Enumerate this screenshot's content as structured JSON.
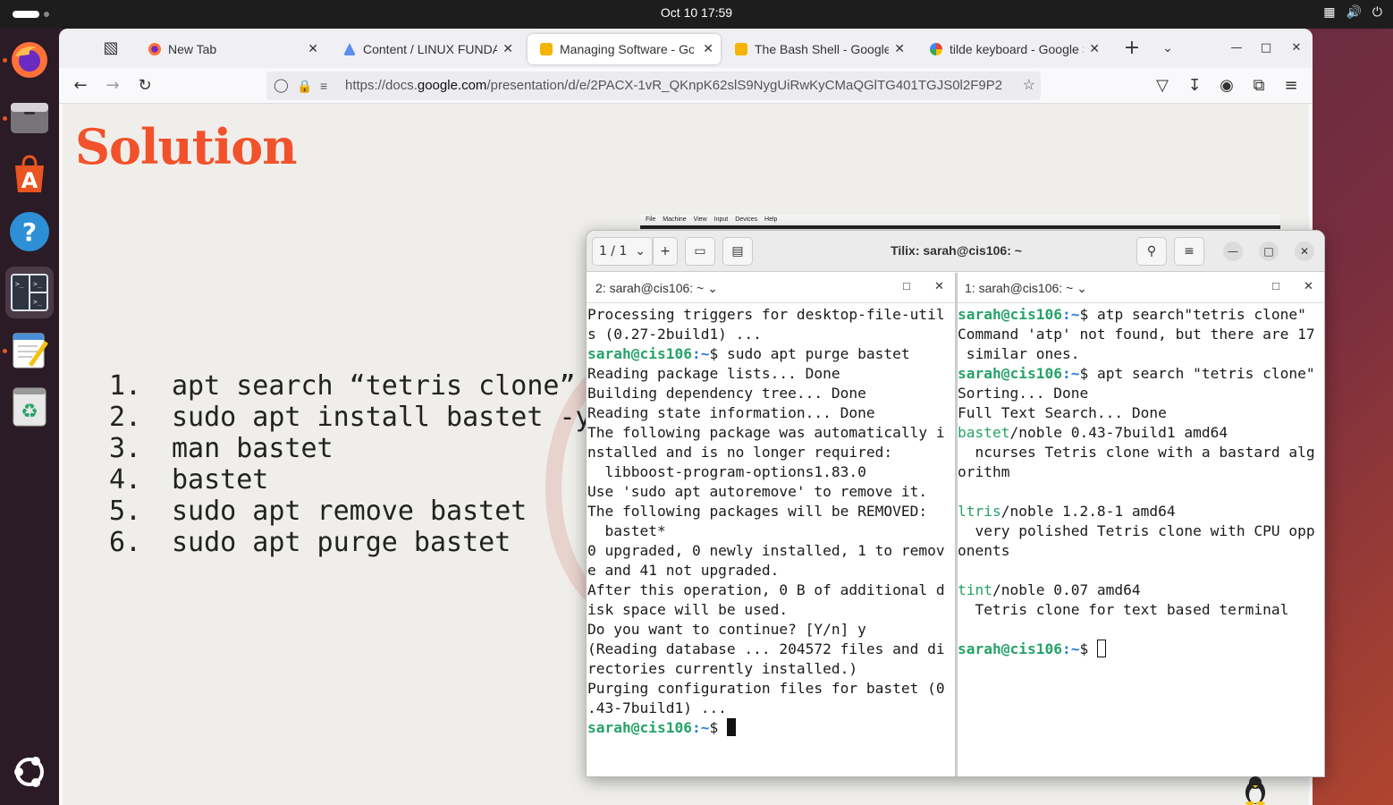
{
  "topbar": {
    "clock": "Oct 10  17:59"
  },
  "dock": {
    "items": [
      "firefox-icon",
      "files-icon",
      "app-center-icon",
      "help-icon",
      "tilix-icon",
      "text-editor-icon",
      "trash-icon",
      "ubuntu-apps-icon"
    ]
  },
  "browser": {
    "tabs": [
      {
        "label": "New Tab",
        "favicon": "firefox-icon",
        "active": false
      },
      {
        "label": "Content / LINUX FUNDA",
        "favicon": "d2l-icon",
        "active": false
      },
      {
        "label": "Managing Software - Go",
        "favicon": "slides-icon",
        "active": true
      },
      {
        "label": "The Bash Shell - Google S",
        "favicon": "slides-icon",
        "active": false
      },
      {
        "label": "tilde keyboard - Google S",
        "favicon": "google-icon",
        "active": false
      }
    ],
    "url": {
      "scheme": "https://docs.",
      "domain": "google.com",
      "path": "/presentation/d/e/2PACX-1vR_QKnpK62slS9NygUiRwKyCMaQGlTG401TGJS0l2F9P2"
    }
  },
  "slide": {
    "title": "Solution",
    "items": [
      {
        "n": "1.",
        "text": "apt search “tetris clone”"
      },
      {
        "n": "2.",
        "text": "sudo apt install bastet -y"
      },
      {
        "n": "3.",
        "text": "man bastet"
      },
      {
        "n": "4.",
        "text": "bastet"
      },
      {
        "n": "5.",
        "text": "sudo apt remove bastet"
      },
      {
        "n": "6.",
        "text": "sudo apt purge bastet"
      }
    ]
  },
  "vm_menu": [
    "File",
    "Machine",
    "View",
    "Input",
    "Devices",
    "Help"
  ],
  "tilix": {
    "title": "Tilix: sarah@cis106: ~",
    "session": "1 / 1",
    "left_pane": {
      "title": "2: sarah@cis106: ~",
      "lines": [
        "Processing triggers for desktop-file-util",
        "s (0.27-2build1) ...",
        "sudo apt purge bastet",
        "Reading package lists... Done",
        "Building dependency tree... Done",
        "Reading state information... Done",
        "The following package was automatically i",
        "nstalled and is no longer required:",
        "  libboost-program-options1.83.0",
        "Use 'sudo apt autoremove' to remove it.",
        "The following packages will be REMOVED:",
        "  bastet*",
        "0 upgraded, 0 newly installed, 1 to remov",
        "e and 41 not upgraded.",
        "After this operation, 0 B of additional d",
        "isk space will be used.",
        "Do you want to continue? [Y/n] y",
        "(Reading database ... 204572 files and di",
        "rectories currently installed.)",
        "Purging configuration files for bastet (0",
        ".43-7build1) ..."
      ]
    },
    "right_pane": {
      "title": "1: sarah@cis106: ~",
      "cmd1": "atp search\"tetris clone\"",
      "l2": "Command 'atp' not found, but there are 17",
      "l3": " similar ones.",
      "cmd2": "apt search \"tetris clone\"",
      "l5": "Sorting... Done",
      "l6": "Full Text Search... Done",
      "p1name": "bastet",
      "p1rest": "/noble 0.43-7build1 amd64",
      "p1d1": "  ncurses Tetris clone with a bastard alg",
      "p1d2": "orithm",
      "p2name": "ltris",
      "p2rest": "/noble 1.2.8-1 amd64",
      "p2d1": "  very polished Tetris clone with CPU opp",
      "p2d2": "onents",
      "p3name": "tint",
      "p3rest": "/noble 0.07 amd64",
      "p3d1": "  Tetris clone for text based terminal"
    },
    "prompt_user": "sarah@cis106",
    "prompt_path": ":~",
    "prompt_sign": "$ "
  }
}
